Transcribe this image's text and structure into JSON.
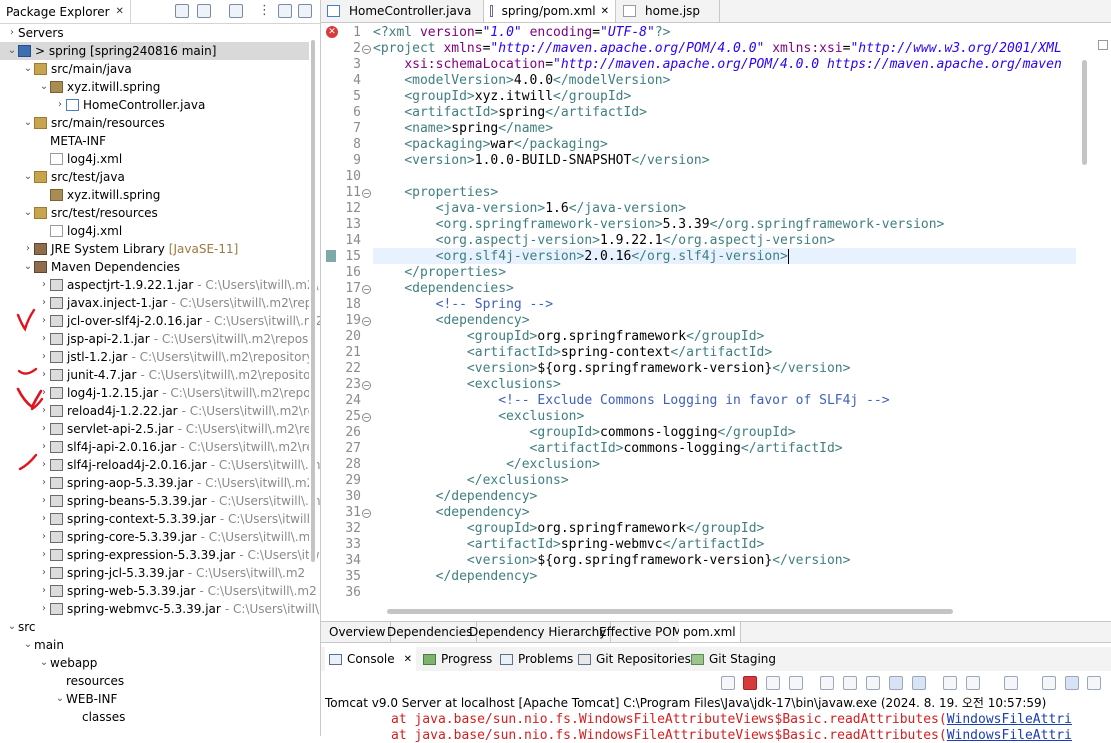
{
  "package_explorer": {
    "tab_title": "Package Explorer",
    "close_glyph": "✕",
    "rows": [
      {
        "label": "Servers",
        "icon": "folder-icon",
        "extra": "",
        "arrow": "›"
      },
      {
        "label": "> spring [spring240816 main]",
        "icon": "project-icon",
        "extra": "",
        "arrow": "⌄"
      },
      {
        "label": "src/main/java",
        "icon": "source-folder-icon",
        "extra": "",
        "arrow": "⌄"
      },
      {
        "label": "xyz.itwill.spring",
        "icon": "package-icon",
        "extra": "",
        "arrow": "⌄"
      },
      {
        "label": "HomeController.java",
        "icon": "java-file-icon",
        "extra": "",
        "arrow": "›"
      },
      {
        "label": "src/main/resources",
        "icon": "source-folder-icon",
        "extra": "",
        "arrow": "⌄"
      },
      {
        "label": "META-INF",
        "icon": "folder-icon",
        "extra": "",
        "arrow": ""
      },
      {
        "label": "log4j.xml",
        "icon": "xml-file-icon",
        "extra": "",
        "arrow": ""
      },
      {
        "label": "src/test/java",
        "icon": "source-folder-icon",
        "extra": "",
        "arrow": "⌄"
      },
      {
        "label": "xyz.itwill.spring",
        "icon": "package-icon",
        "extra": "",
        "arrow": ""
      },
      {
        "label": "src/test/resources",
        "icon": "source-folder-icon",
        "extra": "",
        "arrow": "⌄"
      },
      {
        "label": "log4j.xml",
        "icon": "xml-file-icon",
        "extra": "",
        "arrow": ""
      },
      {
        "label": "JRE System Library",
        "icon": "library-icon",
        "extra": "[JavaSE-11]",
        "arrow": "›"
      },
      {
        "label": "Maven Dependencies",
        "icon": "library-icon",
        "extra": "",
        "arrow": "⌄"
      },
      {
        "label": "aspectjrt-1.9.22.1.jar",
        "icon": "jar-icon",
        "extra": "- C:\\Users\\itwill\\.m2\\",
        "arrow": "›"
      },
      {
        "label": "javax.inject-1.jar",
        "icon": "jar-icon",
        "extra": "- C:\\Users\\itwill\\.m2\\rep",
        "arrow": "›"
      },
      {
        "label": "jcl-over-slf4j-2.0.16.jar",
        "icon": "jar-icon",
        "extra": "- C:\\Users\\itwill\\.m2",
        "arrow": "›"
      },
      {
        "label": "jsp-api-2.1.jar",
        "icon": "jar-icon",
        "extra": "- C:\\Users\\itwill\\.m2\\repos",
        "arrow": "›"
      },
      {
        "label": "jstl-1.2.jar",
        "icon": "jar-icon",
        "extra": "- C:\\Users\\itwill\\.m2\\repository",
        "arrow": "›"
      },
      {
        "label": "junit-4.7.jar",
        "icon": "jar-icon",
        "extra": "- C:\\Users\\itwill\\.m2\\reposito",
        "arrow": "›"
      },
      {
        "label": "log4j-1.2.15.jar",
        "icon": "jar-icon",
        "extra": "- C:\\Users\\itwill\\.m2\\repo",
        "arrow": "›"
      },
      {
        "label": "reload4j-1.2.22.jar",
        "icon": "jar-icon",
        "extra": "- C:\\Users\\itwill\\.m2\\re",
        "arrow": "›"
      },
      {
        "label": "servlet-api-2.5.jar",
        "icon": "jar-icon",
        "extra": "- C:\\Users\\itwill\\.m2\\re",
        "arrow": "›"
      },
      {
        "label": "slf4j-api-2.0.16.jar",
        "icon": "jar-icon",
        "extra": "- C:\\Users\\itwill\\.m2\\re",
        "arrow": "›"
      },
      {
        "label": "slf4j-reload4j-2.0.16.jar",
        "icon": "jar-icon",
        "extra": "- C:\\Users\\itwill\\.m",
        "arrow": "›"
      },
      {
        "label": "spring-aop-5.3.39.jar",
        "icon": "jar-icon",
        "extra": "- C:\\Users\\itwill\\.m2",
        "arrow": "›"
      },
      {
        "label": "spring-beans-5.3.39.jar",
        "icon": "jar-icon",
        "extra": "- C:\\Users\\itwill\\.m2",
        "arrow": "›"
      },
      {
        "label": "spring-context-5.3.39.jar",
        "icon": "jar-icon",
        "extra": "- C:\\Users\\itwill\\",
        "arrow": "›"
      },
      {
        "label": "spring-core-5.3.39.jar",
        "icon": "jar-icon",
        "extra": "- C:\\Users\\itwill\\.m2",
        "arrow": "›"
      },
      {
        "label": "spring-expression-5.3.39.jar",
        "icon": "jar-icon",
        "extra": "- C:\\Users\\itwi",
        "arrow": "›"
      },
      {
        "label": "spring-jcl-5.3.39.jar",
        "icon": "jar-icon",
        "extra": "- C:\\Users\\itwill\\.m2",
        "arrow": "›"
      },
      {
        "label": "spring-web-5.3.39.jar",
        "icon": "jar-icon",
        "extra": "- C:\\Users\\itwill\\.m2",
        "arrow": "›"
      },
      {
        "label": "spring-webmvc-5.3.39.jar",
        "icon": "jar-icon",
        "extra": "- C:\\Users\\itwill\\.m",
        "arrow": "›"
      },
      {
        "label": "src",
        "icon": "folder-icon",
        "extra": "",
        "arrow": "⌄"
      },
      {
        "label": "main",
        "icon": "folder-icon",
        "extra": "",
        "arrow": "⌄"
      },
      {
        "label": "webapp",
        "icon": "folder-icon",
        "extra": "",
        "arrow": "⌄"
      },
      {
        "label": "resources",
        "icon": "folder-icon",
        "extra": "",
        "arrow": ""
      },
      {
        "label": "WEB-INF",
        "icon": "folder-icon",
        "extra": "",
        "arrow": "⌄"
      },
      {
        "label": "classes",
        "icon": "folder-icon",
        "extra": "",
        "arrow": ""
      }
    ]
  },
  "editor": {
    "tabs": [
      {
        "label": "HomeController.java",
        "icon": "java-file-icon",
        "active": false
      },
      {
        "label": "spring/pom.xml",
        "icon": "maven-pom-icon",
        "active": true
      },
      {
        "label": "home.jsp",
        "icon": "jsp-file-icon",
        "active": false
      }
    ],
    "line_numbers": [
      "1",
      "2",
      "3",
      "4",
      "5",
      "6",
      "7",
      "8",
      "9",
      "10",
      "11",
      "12",
      "13",
      "14",
      "15",
      "16",
      "17",
      "18",
      "19",
      "20",
      "21",
      "22",
      "23",
      "24",
      "25",
      "26",
      "27",
      "28",
      "29",
      "30",
      "31",
      "32",
      "33",
      "34",
      "35",
      "36"
    ],
    "current_line": "15",
    "error_marker": "✕",
    "fold_glyph": "−"
  },
  "pom_tabs": [
    "Overview",
    "Dependencies",
    "Dependency Hierarchy",
    "Effective POM",
    "pom.xml"
  ],
  "pom_tab_active": "pom.xml",
  "console": {
    "tabs": [
      {
        "label": "Console",
        "icon": "console-icon",
        "active": true,
        "closable": true
      },
      {
        "label": "Progress",
        "icon": "progress-icon",
        "active": false,
        "closable": false
      },
      {
        "label": "Problems",
        "icon": "problems-icon",
        "active": false,
        "closable": false
      },
      {
        "label": "Git Repositories",
        "icon": "git-repositories-icon",
        "active": false,
        "closable": false
      },
      {
        "label": "Git Staging",
        "icon": "git-staging-icon",
        "active": false,
        "closable": false
      }
    ],
    "close_glyph": "✕",
    "title": "Tomcat v9.0 Server at localhost [Apache Tomcat] C:\\Program Files\\Java\\jdk-17\\bin\\javaw.exe  (2024. 8. 19. 오전 10:57:59)",
    "lines": [
      {
        "prefix": "at java.base/sun.nio.fs.WindowsFileAttributeViews$Basic.readAttributes(",
        "link": "WindowsFileAttri"
      },
      {
        "prefix": "at java.base/sun.nio.fs.WindowsFileAttributeViews$Basic.readAttributes(",
        "link": "WindowsFileAttri"
      }
    ]
  },
  "colors": {
    "xml_tag": "#3f7f7f",
    "xml_attribute": "#7f007f",
    "xml_string": "#2a00ff",
    "xml_comment": "#3f5fbf",
    "console_error": "#d42020",
    "annotation_marks": "#e0141e",
    "selection": "#d9d9d9",
    "current_line": "#e8f2fe"
  }
}
